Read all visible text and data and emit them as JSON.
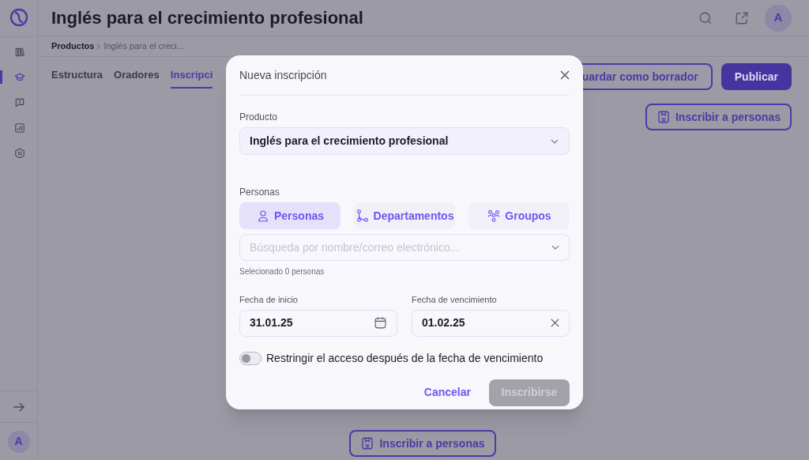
{
  "sidebar": {
    "nav": [
      {
        "kind": "library",
        "selected": false
      },
      {
        "kind": "course",
        "selected": true
      },
      {
        "kind": "feedback",
        "selected": false
      },
      {
        "kind": "reports",
        "selected": false
      },
      {
        "kind": "settings",
        "selected": false
      }
    ],
    "avatar": "A"
  },
  "header": {
    "title": "Inglés para el crecimiento profesional",
    "avatar": "A"
  },
  "breadcrumb": [
    "Productos",
    "Inglés para el creci..."
  ],
  "tabs": [
    {
      "label": "Estructura",
      "selected": false
    },
    {
      "label": "Oradores",
      "selected": false
    },
    {
      "label": "Inscripci",
      "selected": true
    }
  ],
  "actions": {
    "draft": "uardar como borrador",
    "publish": "Publicar",
    "enroll_top": "Inscribir a personas",
    "enroll_bottom": "Inscribir a personas"
  },
  "dialog": {
    "title": "Nueva inscripción",
    "product": {
      "label": "Producto",
      "value": "Inglés para el crecimiento profesional"
    },
    "people": {
      "label": "Personas",
      "modes": [
        {
          "kind": "person",
          "label": "Personas",
          "selected": true
        },
        {
          "kind": "department",
          "label": "Departamentos",
          "selected": false
        },
        {
          "kind": "group",
          "label": "Groupos",
          "selected": false
        }
      ],
      "search": {
        "placeholder": "Búsqueda por nombre/correo electrónico..."
      },
      "hint": "Selecionado 0 personas"
    },
    "start": {
      "label": "Fecha de inicio",
      "value": "31.01.25"
    },
    "end": {
      "label": "Fecha de vencimiento",
      "value": "01.02.25"
    },
    "restrict": {
      "label": "Restringir el acceso después de la fecha de vencimiento",
      "on": false
    },
    "cancel": "Cancelar",
    "submit": {
      "label": "Inscribirse",
      "disabled": true
    }
  }
}
